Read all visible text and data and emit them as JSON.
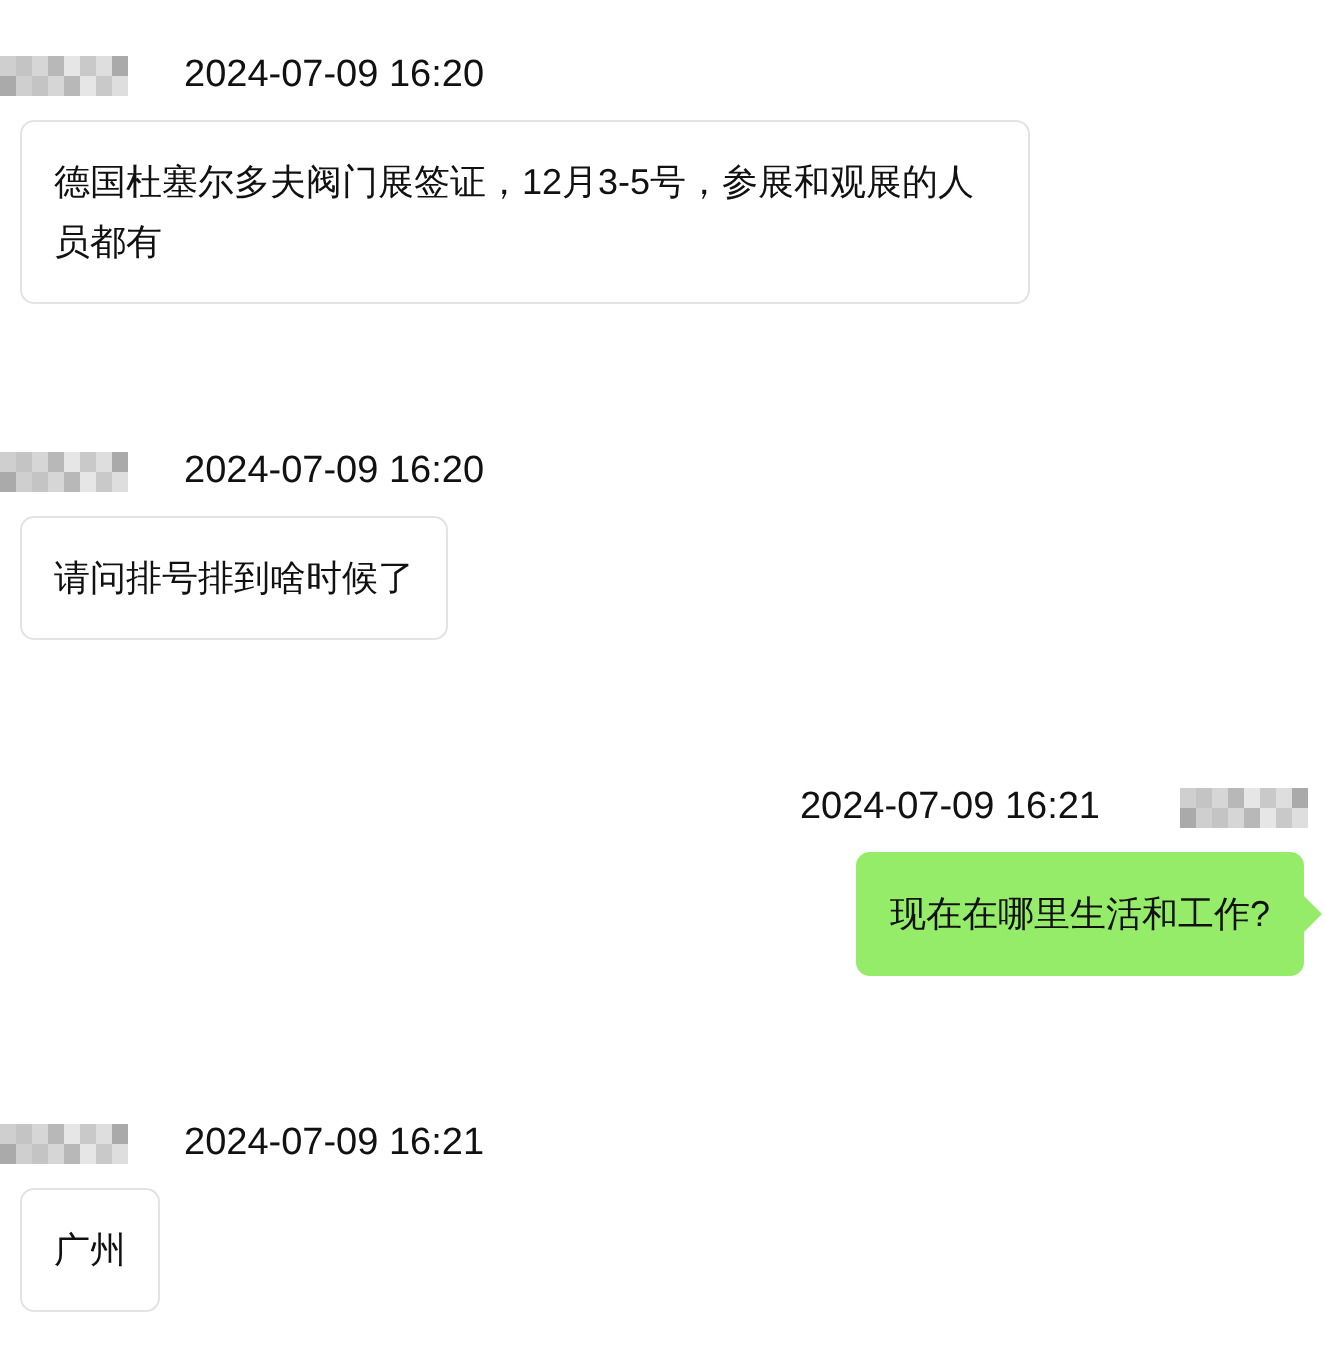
{
  "messages": [
    {
      "kind": "incoming",
      "time": "2024-07-09 16:20",
      "text": "德国杜塞尔多夫阀门展签证，12月3-5号，参展和观展的人员都有"
    },
    {
      "kind": "incoming",
      "time": "2024-07-09 16:20",
      "text": "请问排号排到啥时候了"
    },
    {
      "kind": "outgoing",
      "time": "2024-07-09 16:21",
      "text": "现在在哪里生活和工作?"
    },
    {
      "kind": "incoming",
      "time": "2024-07-09 16:21",
      "text": "广州"
    }
  ]
}
